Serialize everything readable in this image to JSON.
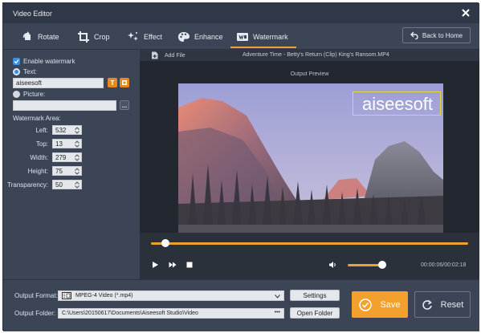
{
  "window": {
    "title": "Video Editor"
  },
  "toolbar": {
    "tabs": [
      {
        "label": "Rotate",
        "icon": "rotate-icon"
      },
      {
        "label": "Crop",
        "icon": "crop-icon"
      },
      {
        "label": "Effect",
        "icon": "effect-icon"
      },
      {
        "label": "Enhance",
        "icon": "enhance-icon"
      },
      {
        "label": "Watermark",
        "icon": "watermark-icon"
      }
    ],
    "active_tab": "Watermark",
    "back_label": "Back to Home"
  },
  "watermark": {
    "enable_label": "Enable watermark",
    "enabled": true,
    "text_label": "Text:",
    "text_value": "aiseesoft",
    "text_selected": true,
    "picture_label": "Picture:",
    "picture_value": "",
    "area_label": "Watermark Area:",
    "left_label": "Left:",
    "left_value": "532",
    "top_label": "Top:",
    "top_value": "13",
    "width_label": "Width:",
    "width_value": "279",
    "height_label": "Height:",
    "height_value": "75",
    "transparency_label": "Transparency:",
    "transparency_value": "50",
    "text_tool_label": "T",
    "browse_label": "..."
  },
  "preview": {
    "add_file_label": "Add File",
    "filename": "Adventure Time - Betty's Return (Clip) King's Ransom.MP4",
    "output_preview_label": "Output Preview",
    "watermark_text": "aiseesoft"
  },
  "player": {
    "progress": 0.04,
    "volume": 0.85,
    "timecode": "00:00:06/00:02:18"
  },
  "output": {
    "format_label": "Output Format:",
    "format_value": "MPEG-4 Video (*.mp4)",
    "settings_label": "Settings",
    "folder_label": "Output Folder:",
    "folder_value": "C:\\Users\\20150617\\Documents\\Aiseesoft Studio\\Video",
    "folder_dots": "•••",
    "open_folder_label": "Open Folder",
    "save_label": "Save",
    "reset_label": "Reset"
  },
  "colors": {
    "accent": "#f3a02c",
    "panel": "#3b4555",
    "titlebar": "#2f3846",
    "checkbox": "#3b8de0"
  }
}
